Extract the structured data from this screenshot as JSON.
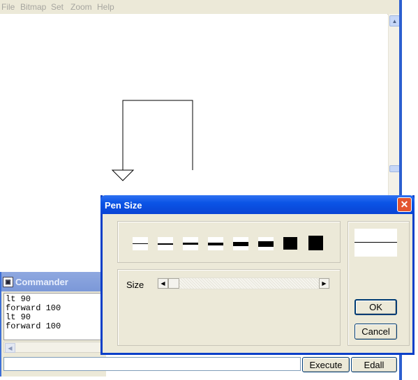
{
  "menu": [
    "File",
    "Bitmap",
    "Set",
    "Zoom",
    "Help"
  ],
  "commander": {
    "title": "Commander",
    "output_lines": [
      "lt 90",
      "forward 100",
      "lt 90",
      "forward 100"
    ],
    "input_value": "",
    "execute_label": "Execute",
    "edall_label": "Edall"
  },
  "pen_dialog": {
    "title": "Pen Size",
    "close_label": "✕",
    "size_label": "Size",
    "ok_label": "OK",
    "cancel_label": "Cancel",
    "swatch_count": 8,
    "selected_size_fraction": 0.0
  },
  "colors": {
    "titlebar_blue": "#0b54e6",
    "dialog_bg": "#ece9d8",
    "close_red": "#e3552f"
  }
}
